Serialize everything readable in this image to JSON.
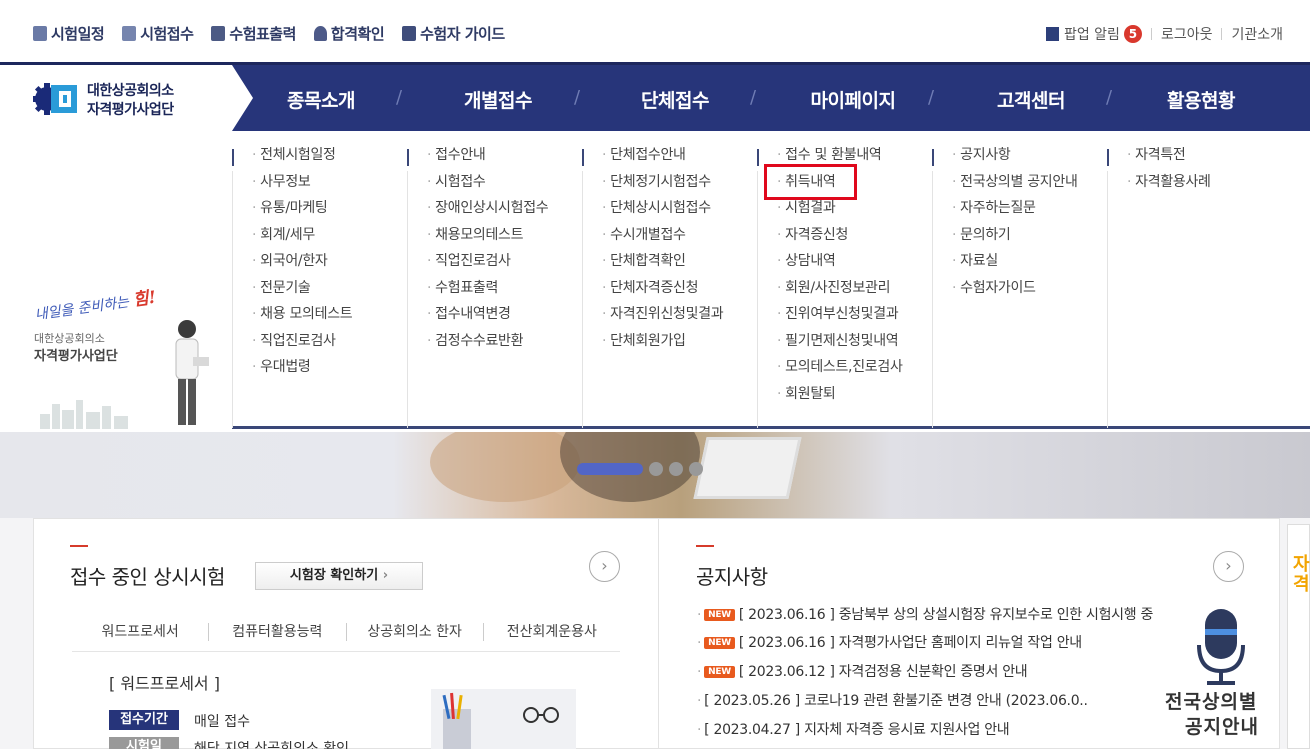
{
  "util_nav": {
    "left": [
      {
        "label": "시험일정",
        "icon": "calendar-icon"
      },
      {
        "label": "시험접수",
        "icon": "pencil-icon"
      },
      {
        "label": "수험표출력",
        "icon": "print-icon"
      },
      {
        "label": "합격확인",
        "icon": "medal-icon"
      },
      {
        "label": "수험자 가이드",
        "icon": "book-icon"
      }
    ],
    "popup_label": "팝업 알림",
    "popup_count": "5",
    "logout": "로그아웃",
    "about": "기관소개"
  },
  "logo": {
    "line1": "대한상공회의소",
    "line2": "자격평가사업단"
  },
  "gnb": [
    "종목소개",
    "개별접수",
    "단체접수",
    "마이페이지",
    "고객센터",
    "활용현황"
  ],
  "dropdown": {
    "columns": [
      [
        "전체시험일정",
        "사무정보",
        "유통/마케팅",
        "회계/세무",
        "외국어/한자",
        "전문기술",
        "채용 모의테스트",
        "직업진로검사",
        "우대법령"
      ],
      [
        "접수안내",
        "시험접수",
        "장애인상시시험접수",
        "채용모의테스트",
        "직업진로검사",
        "수험표출력",
        "접수내역변경",
        "검정수수료반환"
      ],
      [
        "단체접수안내",
        "단체정기시험접수",
        "단체상시시험접수",
        "수시개별접수",
        "단체합격확인",
        "단체자격증신청",
        "자격진위신청및결과",
        "단체회원가입"
      ],
      [
        "접수 및 환불내역",
        "취득내역",
        "시험결과",
        "자격증신청",
        "상담내역",
        "회원/사진정보관리",
        "진위여부신청및결과",
        "필기면제신청및내역",
        "모의테스트,진로검사",
        "회원탈퇴"
      ],
      [
        "공지사항",
        "전국상의별 공지안내",
        "자주하는질문",
        "문의하기",
        "자료실",
        "수험자가이드"
      ],
      [
        "자격특전",
        "자격활용사례"
      ]
    ],
    "promo": {
      "script_a": "내일을 준비하는 ",
      "script_b": "힘!",
      "org1": "대한상공회의소",
      "org2": "자격평가사업단"
    }
  },
  "exam_box": {
    "title": "접수 중인 상시시험",
    "check_button": "시험장 확인하기",
    "check_arrow": "›",
    "more": "›",
    "tabs": [
      "워드프로세서",
      "컴퓨터활용능력",
      "상공회의소 한자",
      "전산회계운용사"
    ],
    "category": "[ 워드프로세서 ]",
    "period_label": "접수기간",
    "period_value": "매일 접수",
    "date_label": "시험일",
    "date_value": "해당 지역 상공회의소 확인"
  },
  "notice_box": {
    "title": "공지사항",
    "more": "›",
    "new_badge": "NEW",
    "items": [
      {
        "text": "[ 2023.06.16 ] 중남북부 상의 상설시험장 유지보수로 인한 시험시행 중",
        "new": true
      },
      {
        "text": "[ 2023.06.16 ] 자격평가사업단 홈페이지 리뉴얼 작업 안내",
        "new": true
      },
      {
        "text": "[ 2023.06.12 ] 자격검정용 신분확인 증명서 안내",
        "new": true
      },
      {
        "text": "[ 2023.05.26 ] 코로나19 관련 환불기준 변경 안내 (2023.06.0..",
        "new": false
      },
      {
        "text": "[ 2023.04.27 ] 지자체 자격증 응시료 지원사업 안내",
        "new": false
      }
    ],
    "side_line1": "전국상의별",
    "side_line2": "공지안내"
  },
  "side_box": {
    "text": "자격"
  },
  "colors": {
    "navy": "#27357a",
    "highlight": "#e0081c",
    "new": "#e85a1e",
    "pager": "#5266c7"
  }
}
